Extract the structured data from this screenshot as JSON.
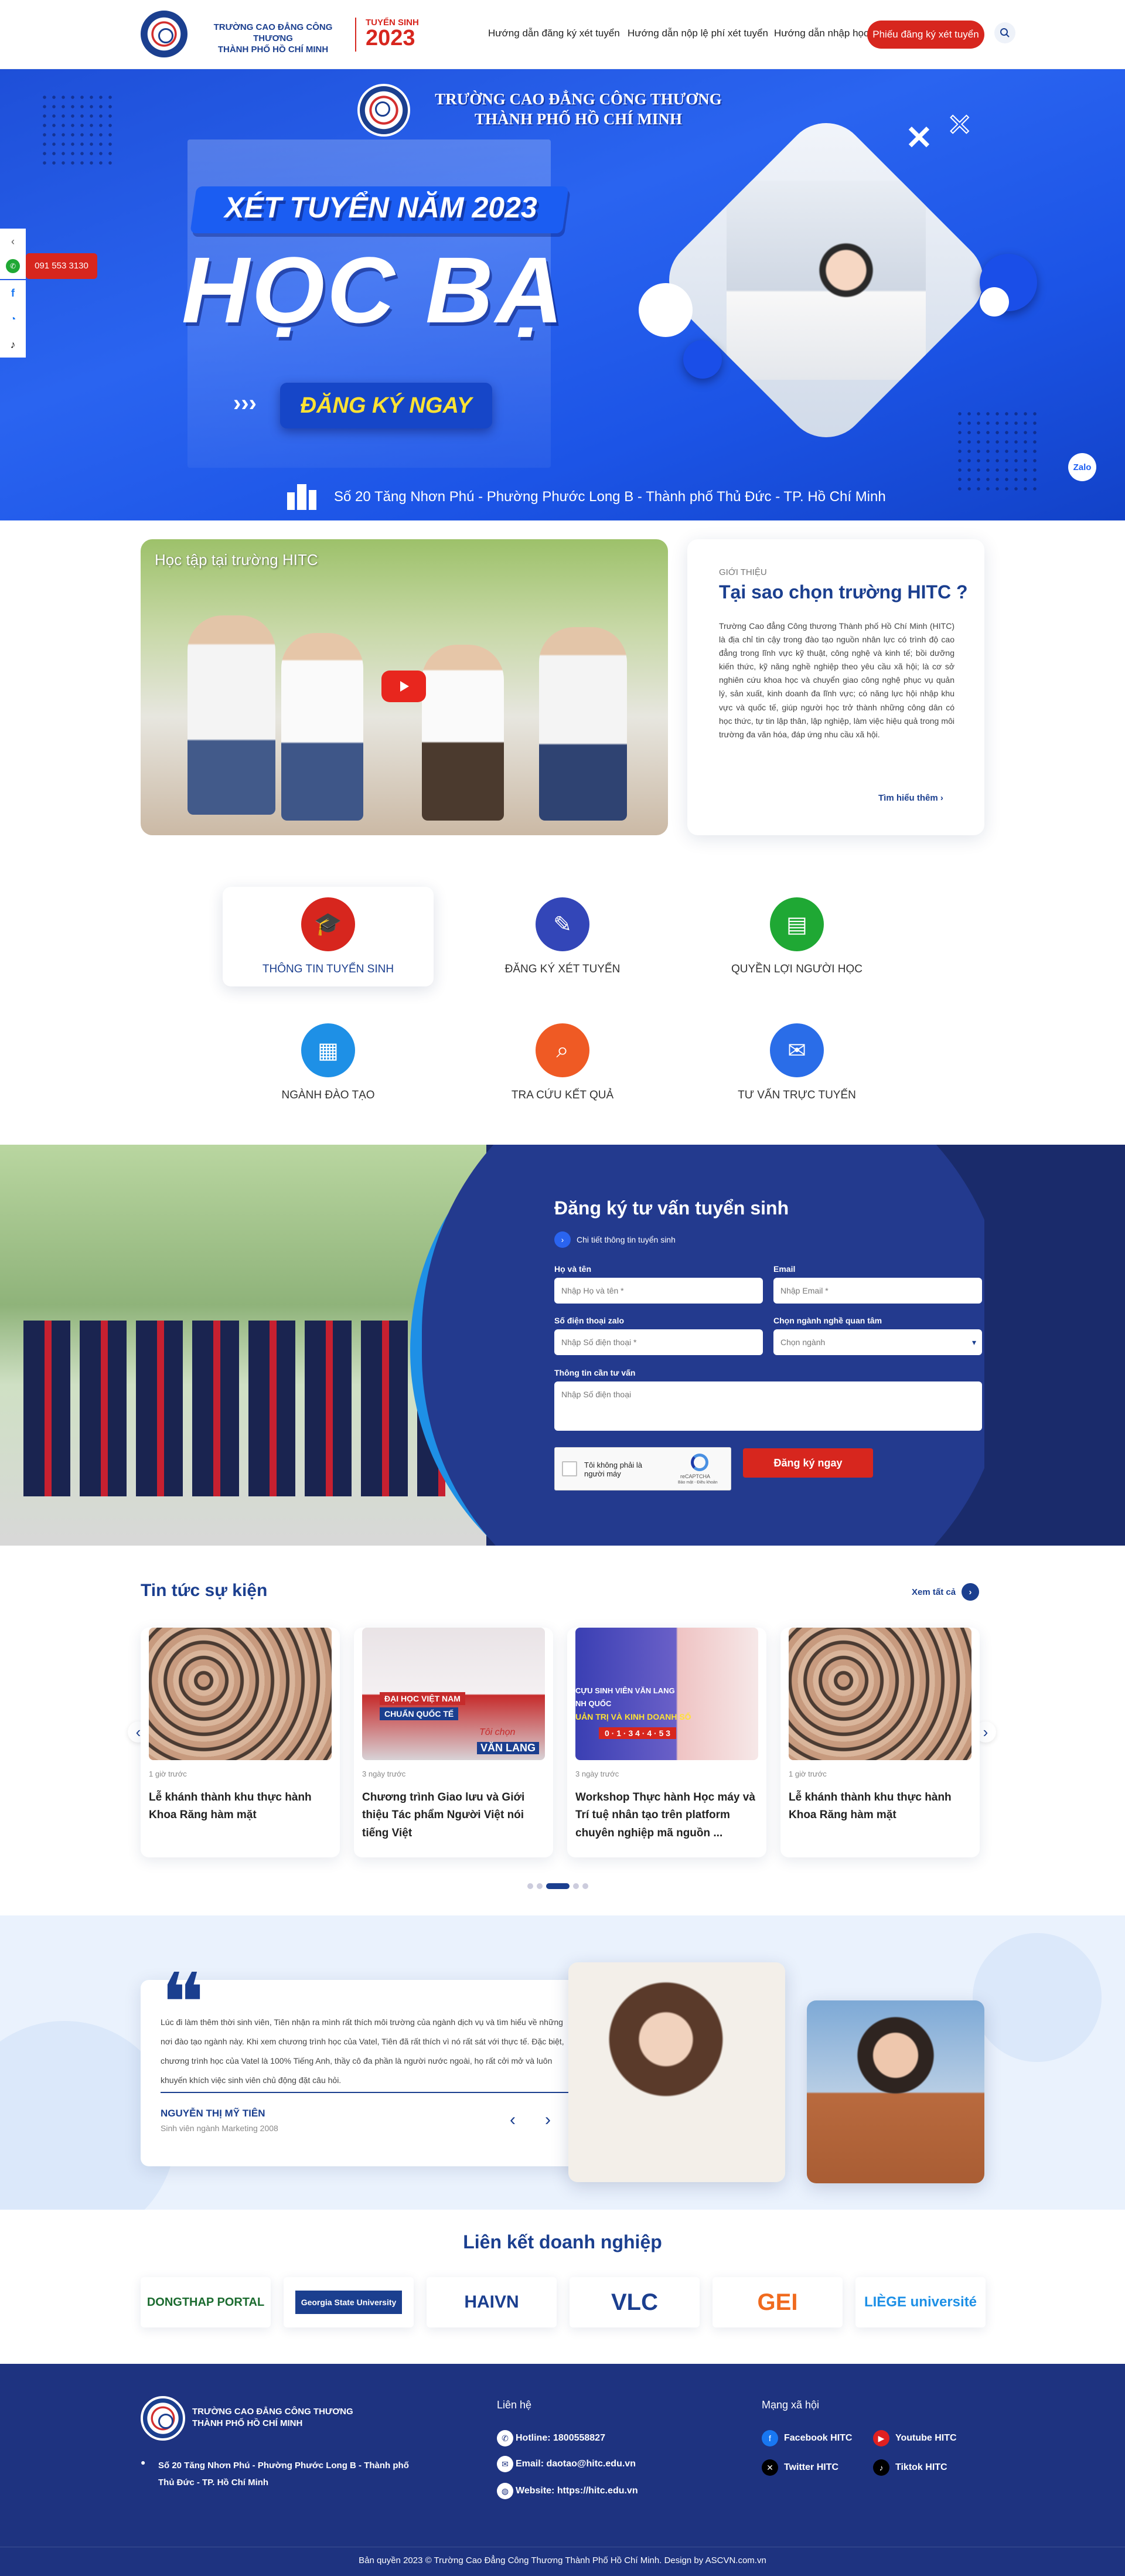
{
  "header": {
    "school_line1": "TRƯỜNG CAO ĐẲNG CÔNG THƯƠNG",
    "school_line2": "THÀNH PHỐ HỒ CHÍ MINH",
    "admission_label": "TUYỂN SINH",
    "admission_year": "2023",
    "nav": [
      "Hướng dẫn đăng ký xét tuyển",
      "Hướng dẫn nộp lệ phí xét tuyển",
      "Hướng dẫn nhập học"
    ],
    "cta": "Phiếu đăng ký xét tuyển"
  },
  "hero": {
    "school_line1": "TRƯỜNG CAO ĐẲNG CÔNG THƯƠNG",
    "school_line2": "THÀNH PHỐ HỒ CHÍ MINH",
    "tagline": "XÉT TUYỂN NĂM 2023",
    "headline": "HỌC BẠ",
    "register": "ĐĂNG KÝ NGAY",
    "address": "Số 20 Tăng Nhơn Phú - Phường Phước Long B - Thành phố Thủ Đức - TP. Hồ Chí Minh",
    "zalo": "Zalo"
  },
  "side": {
    "phone": "091 553 3130"
  },
  "intro": {
    "video_caption": "Học tập tại trường HITC",
    "kicker": "GIỚI THIỆU",
    "title": "Tại sao chọn trường HITC ?",
    "body": "Trường Cao đẳng Công thương Thành phố Hồ Chí Minh (HITC) là địa chỉ tin cậy trong đào tạo nguồn nhân lực có trình độ cao đẳng trong lĩnh vực kỹ thuật, công nghệ và kinh tế; bồi dưỡng kiến thức, kỹ năng nghề nghiệp theo yêu cầu xã hội; là cơ sở nghiên cứu khoa học và chuyển giao công nghệ phục vụ quản lý, sản xuất, kinh doanh đa lĩnh vực; có năng lực hội nhập khu vực và quốc tế, giúp người học trở thành những công dân có học thức, tự tin lập thân, lập nghiệp, làm việc hiệu quả trong môi trường đa văn hóa, đáp ứng nhu cầu xã hội.",
    "more": "Tìm hiểu thêm"
  },
  "features": [
    {
      "label": "THÔNG TIN TUYỂN SINH",
      "color": "#d7261e",
      "icon": "graduation-cap-icon"
    },
    {
      "label": "ĐĂNG KÝ XÉT TUYỂN",
      "color": "#3346b8",
      "icon": "document-edit-icon"
    },
    {
      "label": "QUYỀN LỢI NGƯỜI HỌC",
      "color": "#1fa834",
      "icon": "certificate-icon"
    },
    {
      "label": "NGÀNH ĐÀO TẠO",
      "color": "#1e90e6",
      "icon": "book-icon"
    },
    {
      "label": "TRA CỨU KẾT QUẢ",
      "color": "#ef5a24",
      "icon": "search-document-icon"
    },
    {
      "label": "TƯ VẤN TRỰC TUYẾN",
      "color": "#2a6de8",
      "icon": "chat-icon"
    }
  ],
  "form": {
    "title": "Đăng ký tư vấn tuyển sinh",
    "detail_link": "Chi tiết thông tin tuyển sinh",
    "name_label": "Họ và tên",
    "name_ph": "Nhập Họ và tên *",
    "email_label": "Email",
    "email_ph": "Nhập Email *",
    "phone_label": "Số điện thoại zalo",
    "phone_ph": "Nhập Số điện thoại *",
    "major_label": "Chọn ngành nghề quan tâm",
    "major_value": "Chọn ngành",
    "info_label": "Thông tin cần tư vấn",
    "info_ph": "Nhập Số điện thoại",
    "captcha": "Tôi không phải là người máy",
    "captcha_brand": "reCAPTCHA",
    "captcha_terms": "Bảo mật - Điều khoản",
    "submit": "Đăng ký ngay"
  },
  "news": {
    "title": "Tin tức sự kiện",
    "view_all": "Xem tất cả",
    "items": [
      {
        "time": "1 giờ trước",
        "title": "Lễ khánh thành khu thực hành Khoa Răng hàm mặt"
      },
      {
        "time": "3 ngày trước",
        "title": "Chương trình Giao lưu và Giới thiệu Tác phẩm Người Việt nói tiếng Việt"
      },
      {
        "time": "3 ngày trước",
        "title": "Workshop Thực hành Học máy và Trí tuệ nhân tạo trên platform chuyên nghiệp mã nguồn ..."
      },
      {
        "time": "1 giờ trước",
        "title": "Lễ khánh thành khu thực hành Khoa Răng hàm mặt"
      }
    ],
    "img2_text1": "ĐẠI HỌC VIỆT NAM",
    "img2_text2": "CHUẨN QUỐC TẾ",
    "img2_text3": "Tôi chọn",
    "img2_text4": "VĂN LANG",
    "img3_text1": "CỰU SINH VIÊN VĂN LANG",
    "img3_text2": "NH QUỐC",
    "img3_text3": "UẢN TRỊ VÀ KINH DOANH SỐ",
    "img3_text4": "0 · 1 · 3 4 · 4 · 5 3"
  },
  "testimonial": {
    "quote": "Lúc đi làm thêm thời sinh viên, Tiên nhận ra mình rất thích môi trường của ngành dịch vụ và tìm hiểu về những nơi đào tạo ngành này. Khi xem chương trình học của Vatel, Tiên đã rất thích vì nó rất sát với thực tế. Đặc biệt, chương trình học của Vatel là 100% Tiếng Anh, thầy cô đa phần là người nước ngoài, họ rất cởi mở và luôn khuyến khích việc sinh viên chủ động đặt câu hỏi.",
    "name": "NGUYỄN THỊ MỸ TIÊN",
    "role": "Sinh viên ngành Marketing 2008"
  },
  "partners": {
    "title": "Liên kết doanh nghiệp",
    "logos": [
      "DONGTHAP PORTAL",
      "Georgia State University",
      "HAIVN",
      "VLC",
      "GEI",
      "LIÈGE université"
    ]
  },
  "footer": {
    "school_line1": "TRƯỜNG CAO ĐẲNG CÔNG THƯƠNG",
    "school_line2": "THÀNH PHỐ HỒ CHÍ MINH",
    "address": "Số 20 Tăng Nhơn Phú - Phường Phước Long B - Thành phố Thủ Đức - TP. Hồ Chí Minh",
    "contact_title": "Liên hệ",
    "hotline": "Hotline: 1800558827",
    "email": "Email: daotao@hitc.edu.vn",
    "website": "Website: https://hitc.edu.vn",
    "social_title": "Mạng xã hội",
    "facebook": "Facebook HITC",
    "youtube": "Youtube HITC",
    "twitter": "Twitter HITC",
    "tiktok": "Tiktok HITC",
    "copyright": "Bản quyền 2023 © Trường Cao Đẳng Công Thương Thành Phố Hồ Chí Minh. Design by ASCVN.com.vn"
  },
  "colors": {
    "primary": "#1b3f8f",
    "accent": "#d7261e",
    "hero": "#2a64f0",
    "footer": "#1e3380"
  }
}
